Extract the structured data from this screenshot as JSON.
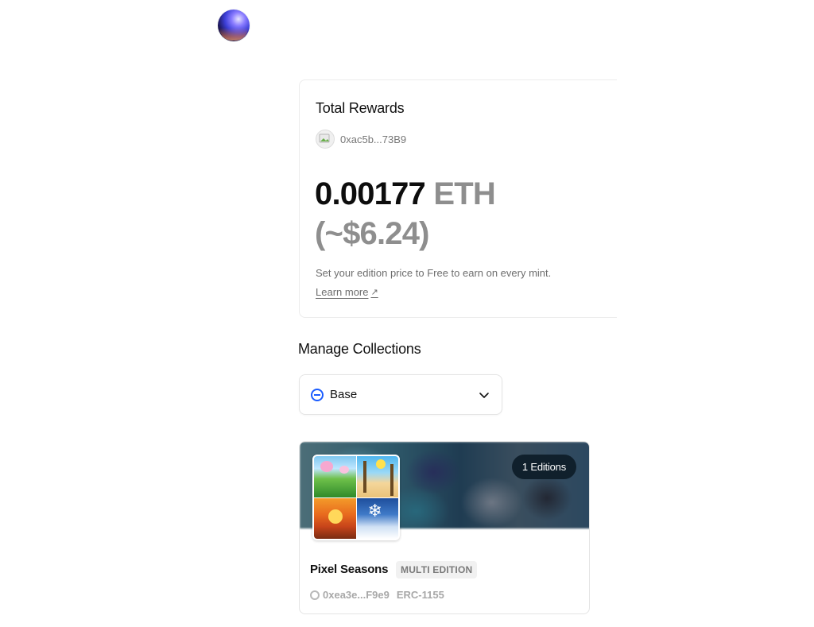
{
  "header": {
    "logo_icon": "zora-orb-logo"
  },
  "rewards": {
    "title": "Total Rewards",
    "wallet_address": "0xac5b...73B9",
    "amount": "0.00177",
    "unit": "ETH",
    "usd": "(~$6.24)",
    "hint": "Set your edition price to Free to earn on every mint.",
    "learn_more": "Learn more",
    "learn_more_icon": "↗"
  },
  "manage": {
    "title": "Manage Collections",
    "chain": {
      "selected": "Base",
      "icon": "base-chain-icon"
    }
  },
  "collection": {
    "editions": "1 Editions",
    "name": "Pixel Seasons",
    "type": "MULTI EDITION",
    "address": "0xea3e...F9e9",
    "standard": "ERC-1155"
  },
  "colors": {
    "accent": "#1a5cff",
    "badge_bg": "#10202c"
  }
}
